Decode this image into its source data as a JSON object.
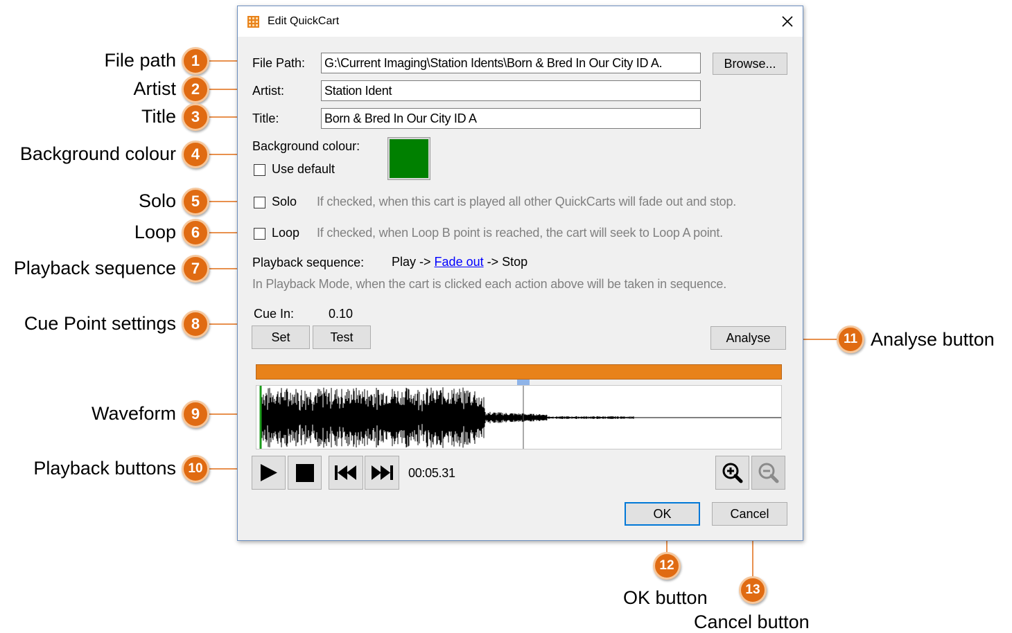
{
  "dialog": {
    "title": "Edit QuickCart",
    "file_path": {
      "label": "File Path:",
      "value": "G:\\Current Imaging\\Station Idents\\Born & Bred In Our City ID A.",
      "browse_label": "Browse..."
    },
    "artist": {
      "label": "Artist:",
      "value": "Station Ident"
    },
    "title_field": {
      "label": "Title:",
      "value": "Born & Bred In Our City ID A"
    },
    "background": {
      "label": "Background colour:",
      "use_default_label": "Use default",
      "use_default_checked": false,
      "color": "#008000"
    },
    "solo": {
      "label": "Solo",
      "checked": false,
      "hint": "If checked, when this cart is played all other QuickCarts will fade out and stop."
    },
    "loop": {
      "label": "Loop",
      "checked": false,
      "hint": "If checked, when Loop B point is reached, the cart will seek to Loop A point."
    },
    "playback": {
      "label": "Playback sequence:",
      "play": "Play ->",
      "fade_out": "Fade out",
      "stop": "-> Stop",
      "hint": "In Playback Mode, when the cart is clicked each action above will be taken in sequence."
    },
    "cue": {
      "label": "Cue In:",
      "value": "0.10",
      "set_label": "Set",
      "test_label": "Test"
    },
    "analyse_label": "Analyse",
    "transport": {
      "time": "00:05.31",
      "icons": [
        "play-icon",
        "stop-icon",
        "skip-back-icon",
        "skip-forward-icon",
        "zoom-in-icon",
        "zoom-out-icon"
      ]
    },
    "ok_label": "OK",
    "cancel_label": "Cancel"
  },
  "callouts": [
    {
      "number": "1",
      "label": "File path"
    },
    {
      "number": "2",
      "label": "Artist"
    },
    {
      "number": "3",
      "label": "Title"
    },
    {
      "number": "4",
      "label": "Background colour"
    },
    {
      "number": "5",
      "label": "Solo"
    },
    {
      "number": "6",
      "label": "Loop"
    },
    {
      "number": "7",
      "label": "Playback sequence"
    },
    {
      "number": "8",
      "label": "Cue Point settings"
    },
    {
      "number": "9",
      "label": "Waveform"
    },
    {
      "number": "10",
      "label": "Playback buttons"
    },
    {
      "number": "11",
      "label": "Analyse button"
    },
    {
      "number": "12",
      "label": "OK button"
    },
    {
      "number": "13",
      "label": "Cancel button"
    }
  ],
  "colors": {
    "accent": "#e06b12",
    "progress": "#e8821a",
    "focus": "#0078d7",
    "cue_marker": "#8fb4e8"
  }
}
